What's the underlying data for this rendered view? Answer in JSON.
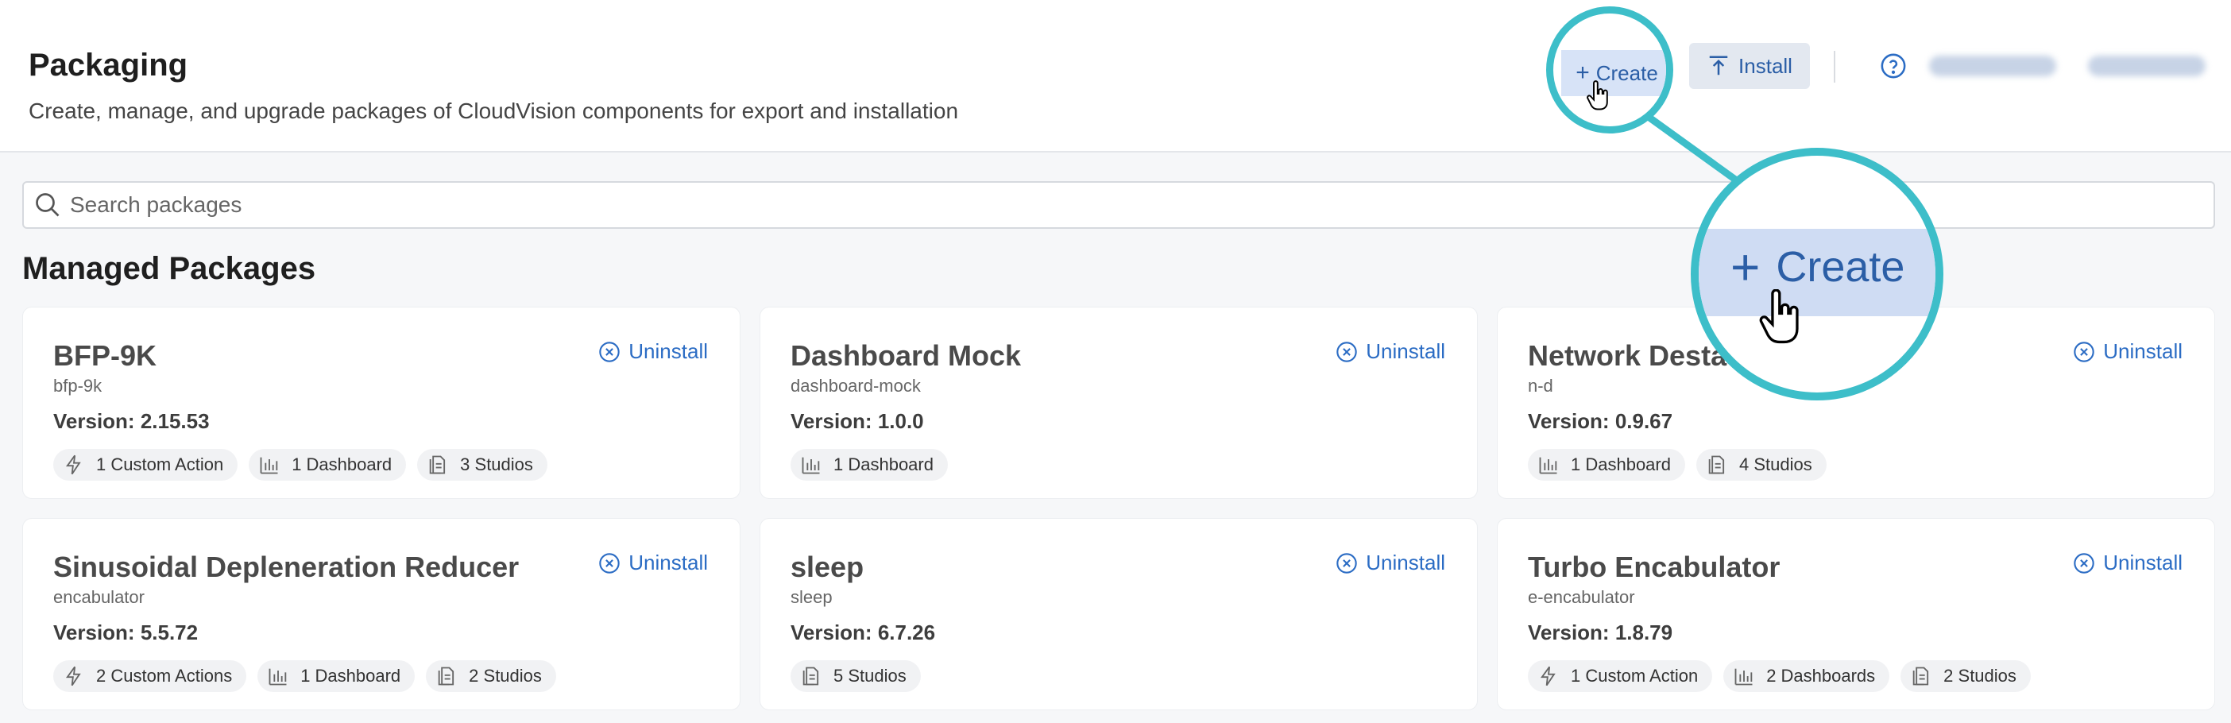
{
  "header": {
    "title": "Packaging",
    "subtitle": "Create, manage, and upgrade packages of CloudVision components for export and installation",
    "create_label": "Create",
    "install_label": "Install",
    "help_icon": "help-circle-icon"
  },
  "search": {
    "placeholder": "Search packages",
    "value": ""
  },
  "section_title": "Managed Packages",
  "uninstall_label": "Uninstall",
  "zoom": {
    "label": "Create"
  },
  "colors": {
    "accent": "#2b6cc4",
    "callout": "#3dbec9",
    "button_bg": "#d7e3f7"
  },
  "packages": [
    {
      "name": "BFP-9K",
      "id": "bfp-9k",
      "version": "Version: 2.15.53",
      "chips": [
        {
          "icon": "lightning-icon",
          "label": "1 Custom Action"
        },
        {
          "icon": "bar-chart-icon",
          "label": "1 Dashboard"
        },
        {
          "icon": "document-icon",
          "label": "3 Studios"
        }
      ]
    },
    {
      "name": "Dashboard Mock",
      "id": "dashboard-mock",
      "version": "Version: 1.0.0",
      "chips": [
        {
          "icon": "bar-chart-icon",
          "label": "1 Dashboard"
        }
      ]
    },
    {
      "name": "Network Desta",
      "id": "n-d",
      "version": "Version: 0.9.67",
      "chips": [
        {
          "icon": "bar-chart-icon",
          "label": "1 Dashboard"
        },
        {
          "icon": "document-icon",
          "label": "4 Studios"
        }
      ]
    },
    {
      "name": "Sinusoidal Depleneration Reducer",
      "id": "encabulator",
      "version": "Version: 5.5.72",
      "chips": [
        {
          "icon": "lightning-icon",
          "label": "2 Custom Actions"
        },
        {
          "icon": "bar-chart-icon",
          "label": "1 Dashboard"
        },
        {
          "icon": "document-icon",
          "label": "2 Studios"
        }
      ]
    },
    {
      "name": "sleep",
      "id": "sleep",
      "version": "Version: 6.7.26",
      "chips": [
        {
          "icon": "document-icon",
          "label": "5 Studios"
        }
      ]
    },
    {
      "name": "Turbo Encabulator",
      "id": "e-encabulator",
      "version": "Version: 1.8.79",
      "chips": [
        {
          "icon": "lightning-icon",
          "label": "1 Custom Action"
        },
        {
          "icon": "bar-chart-icon",
          "label": "2 Dashboards"
        },
        {
          "icon": "document-icon",
          "label": "2 Studios"
        }
      ]
    }
  ]
}
